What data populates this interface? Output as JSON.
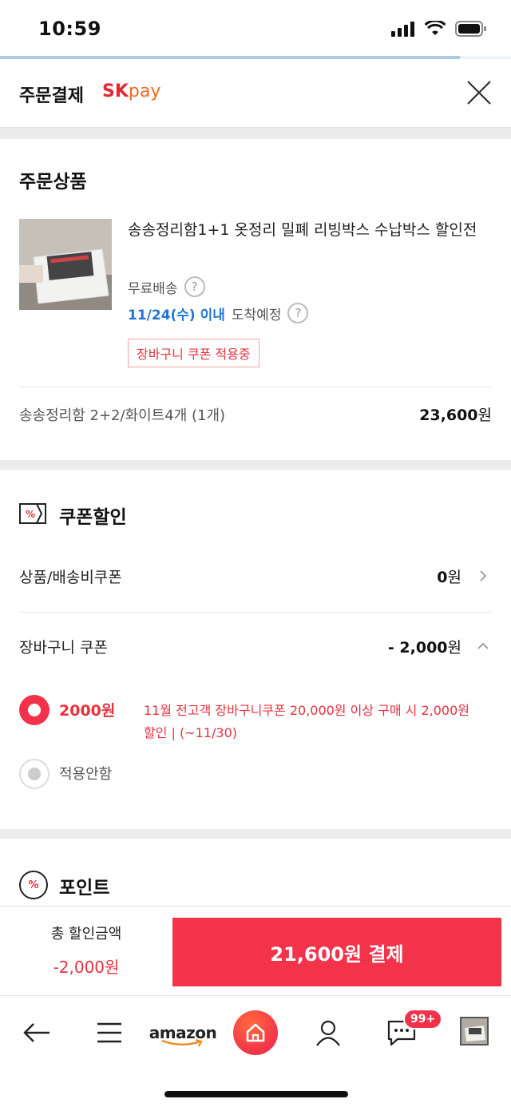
{
  "status_bar": {
    "time": "10:59"
  },
  "load_progress": 0.9,
  "header": {
    "title": "주문결제",
    "brand_sk": "SK",
    "brand_pay": "pay"
  },
  "order": {
    "section_title": "주문상품",
    "product_name": "송송정리함1+1 옷정리 밀폐 리빙박스 수납박스 할인전",
    "shipping": "무료배송",
    "arrival_date": "11/24(수) 이내",
    "arrival_text": "도착예정",
    "coupon_tag": "장바구니 쿠폰 적용중",
    "option_name": "송송정리함 2+2/화이트4개 (1개)",
    "option_price": "23,600",
    "won": "원"
  },
  "coupon": {
    "section_title": "쿠폰할인",
    "icon_text": "%",
    "product_coupon_label": "상품/배송비쿠폰",
    "product_coupon_value": "0",
    "cart_coupon_label": "장바구니 쿠폰",
    "cart_coupon_value": "- 2,000",
    "won": "원",
    "options": [
      {
        "label": "2000원",
        "desc": "11월 전고객 장바구니쿠폰 20,000원 이상 구매 시 2,000원 할인 | (~11/30)",
        "selected": true
      },
      {
        "label": "적용안함",
        "selected": false
      }
    ]
  },
  "point": {
    "section_title": "포인트",
    "icon_text": "%"
  },
  "paybar": {
    "total_label": "총 할인금액",
    "total_value": "-2,000원",
    "pay_button": "21,600원 결제"
  },
  "bottom_nav": {
    "amazon": "amazon",
    "badge": "99+"
  },
  "colors": {
    "accent": "#f2334a",
    "link_blue": "#2475d6"
  }
}
